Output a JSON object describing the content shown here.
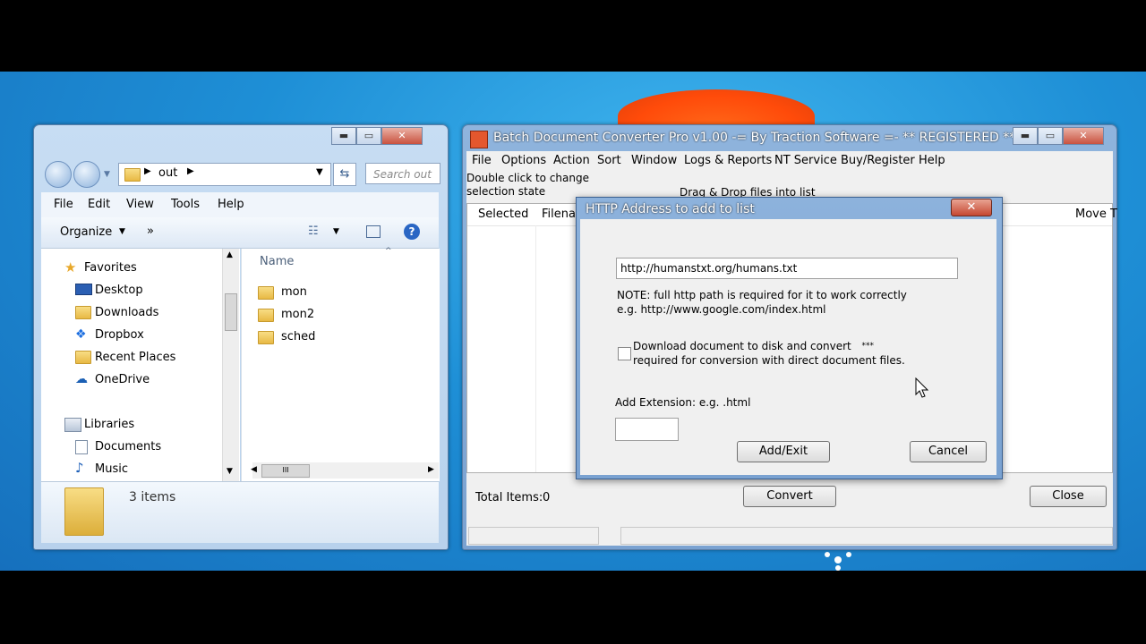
{
  "explorer": {
    "address": {
      "crumb": "out"
    },
    "search_placeholder": "Search out",
    "menu": [
      "File",
      "Edit",
      "View",
      "Tools",
      "Help"
    ],
    "toolbar": {
      "organize": "Organize",
      "more": "»"
    },
    "nav": {
      "favorites": "Favorites",
      "items": [
        "Desktop",
        "Downloads",
        "Dropbox",
        "Recent Places",
        "OneDrive"
      ],
      "libraries": "Libraries",
      "lib_items": [
        "Documents",
        "Music"
      ]
    },
    "column_name": "Name",
    "files": [
      "mon",
      "mon2",
      "sched"
    ],
    "status": "3 items"
  },
  "bdc": {
    "title": "Batch Document Converter Pro v1.00 -= By Traction Software =- ** REGISTERED **",
    "menu": [
      "File",
      "Options",
      "Action",
      "Sort",
      "Window",
      "Logs & Reports",
      "NT Service",
      "Buy/Register",
      "Help"
    ],
    "hint_line1": "Double click to change",
    "hint_line2": "selection state",
    "drag_hint": "Drag & Drop files into list",
    "columns": {
      "selected": "Selected",
      "filename": "Filenam",
      "move": "Move T"
    },
    "total_label": "Total Items:",
    "total_value": "0",
    "convert": "Convert",
    "close": "Close"
  },
  "dialog": {
    "title": "HTTP Address to add to list",
    "url_value": "http://humanstxt.org/humans.txt",
    "note1": "NOTE: full http path is required for it to work correctly",
    "note2": "e.g. http://www.google.com/index.html",
    "download1": "Download document to disk and convert",
    "download_stars": "***",
    "download2": "required for conversion with direct document files.",
    "ext_label": "Add Extension:  e.g. .html",
    "add_exit": "Add/Exit",
    "cancel": "Cancel"
  },
  "colors": {
    "desktop": "#1e8fd6",
    "accent_orange": "#ff4b0a",
    "window_frame": "#8fb4dd"
  }
}
